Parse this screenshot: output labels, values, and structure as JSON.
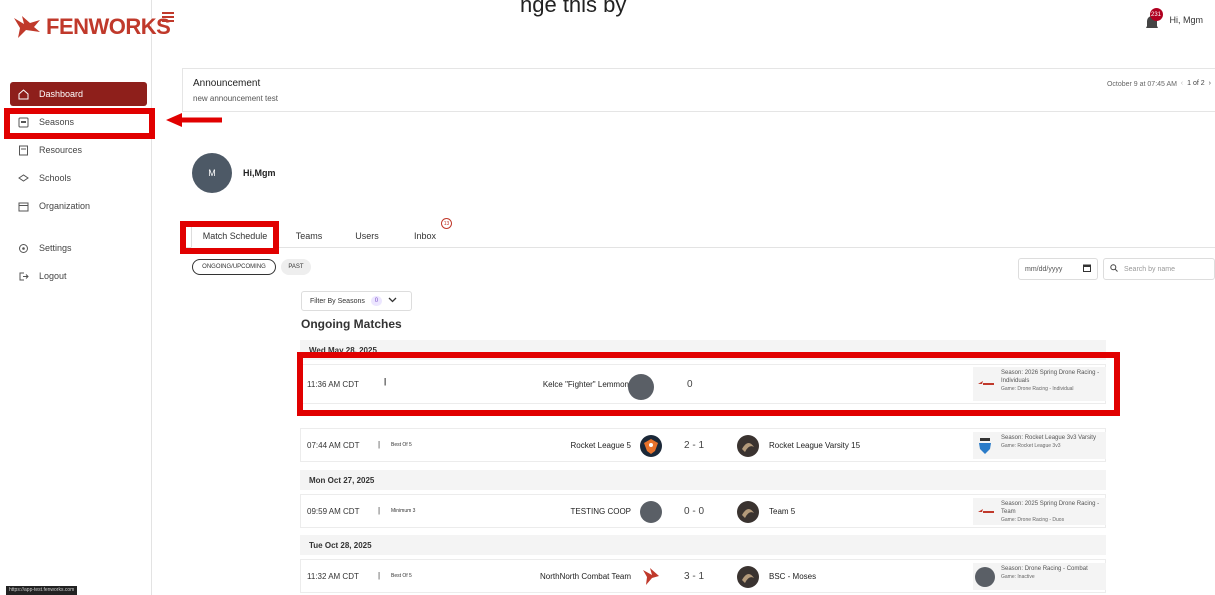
{
  "top_banner": "nge this by",
  "header": {
    "user_greeting": "Hi, Mgm",
    "notification_count": "231"
  },
  "brand": {
    "name": "FENWORKS",
    "color": "#c0392b"
  },
  "sidebar": {
    "items": [
      {
        "label": "Dashboard",
        "icon": "home-icon",
        "active": true
      },
      {
        "label": "Seasons",
        "icon": "trophy-icon",
        "active": false
      },
      {
        "label": "Resources",
        "icon": "book-icon",
        "active": false
      },
      {
        "label": "Schools",
        "icon": "school-icon",
        "active": false
      },
      {
        "label": "Organization",
        "icon": "calendar-icon",
        "active": false
      }
    ],
    "footer_items": [
      {
        "label": "Settings",
        "icon": "gear-icon"
      },
      {
        "label": "Logout",
        "icon": "logout-icon"
      }
    ]
  },
  "announcement": {
    "title": "Announcement",
    "body": "new announcement test",
    "date": "October 9 at 07:45 AM",
    "pager": "1 of 2"
  },
  "profile": {
    "avatar_initial": "M",
    "greeting": "Hi,Mgm"
  },
  "tabs": [
    {
      "label": "Match Schedule",
      "active": true
    },
    {
      "label": "Teams",
      "active": false
    },
    {
      "label": "Users",
      "active": false
    },
    {
      "label": "Inbox",
      "active": false,
      "badge": "13"
    }
  ],
  "filters": {
    "ongoing_label": "ONGOING/UPCOMING",
    "past_label": "PAST",
    "date_placeholder": "mm/dd/yyyy",
    "search_placeholder": "Search by name",
    "season_filter_label": "Filter By Seasons",
    "season_filter_count": "0"
  },
  "section_title": "Ongoing Matches",
  "days": [
    {
      "date": "Wed May 28, 2025",
      "matches": [
        {
          "time": "11:36 AM CDT",
          "format": "",
          "team1": "Kelce \"Fighter\" Lemmon",
          "score": "0",
          "team2": "",
          "season_label": "Season:",
          "season_name": "2026 Spring Drone Racing - Individuals",
          "game": "Game: Drone Racing - Individual"
        }
      ]
    },
    {
      "date": "",
      "matches": [
        {
          "time": "07:44 AM CDT",
          "format": "Best Of 5",
          "team1": "Rocket League 5",
          "score": "2 - 1",
          "team2": "Rocket League Varsity 15",
          "season_label": "Season:",
          "season_name": "Rocket League 3v3 Varsity",
          "game": "Game: Rocket League 3v3"
        }
      ]
    },
    {
      "date": "Mon Oct 27, 2025",
      "matches": [
        {
          "time": "09:59 AM CDT",
          "format": "Minimum 3",
          "team1": "TESTING COOP",
          "score": "0 - 0",
          "team2": "Team 5",
          "season_label": "Season:",
          "season_name": "2025 Spring Drone Racing - Team",
          "game": "Game: Drone Racing - Duos"
        }
      ]
    },
    {
      "date": "Tue Oct 28, 2025",
      "matches": [
        {
          "time": "11:32 AM CDT",
          "format": "Best Of 5",
          "team1": "NorthNorth Combat Team",
          "score": "3 - 1",
          "team2": "BSC - Moses",
          "season_label": "Season:",
          "season_name": "Drone Racing - Combat",
          "game": "Game: Inactive"
        }
      ]
    }
  ],
  "status_url": "https://app-test.fenworks.com",
  "annotation_color": "#e10000"
}
